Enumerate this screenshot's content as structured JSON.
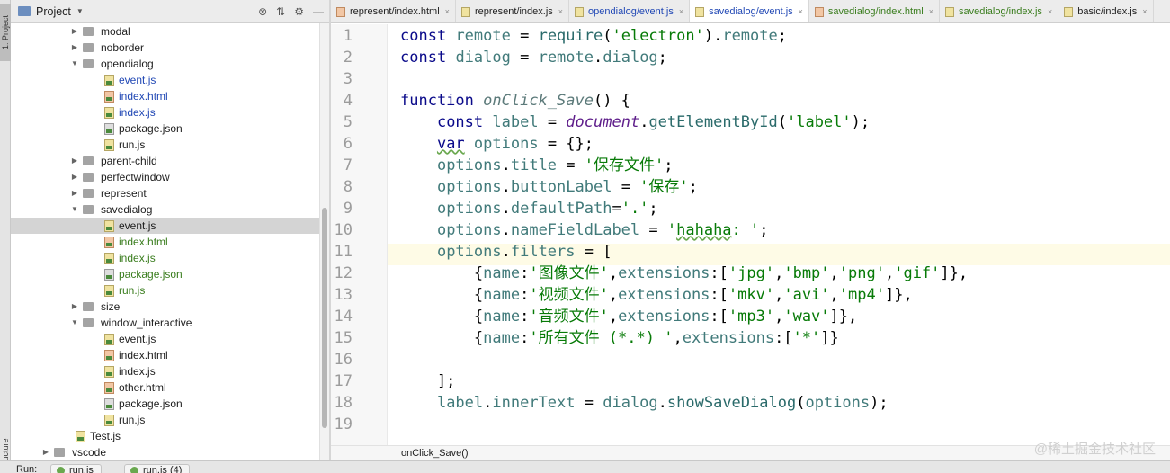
{
  "toolwindow": {
    "project_label": "1: Project",
    "structure_label": "Structure"
  },
  "project_panel": {
    "title": "Project",
    "tools": [
      "⊗",
      "⇅",
      "⚙",
      "—"
    ]
  },
  "tree": [
    {
      "label": "modal",
      "type": "folder",
      "indent": 1,
      "expanded": false,
      "color": "default"
    },
    {
      "label": "noborder",
      "type": "folder",
      "indent": 1,
      "expanded": false,
      "color": "default"
    },
    {
      "label": "opendialog",
      "type": "folder",
      "indent": 1,
      "expanded": true,
      "color": "default"
    },
    {
      "label": "event.js",
      "type": "js",
      "indent": 2,
      "color": "blue"
    },
    {
      "label": "index.html",
      "type": "html",
      "indent": 2,
      "color": "blue"
    },
    {
      "label": "index.js",
      "type": "js",
      "indent": 2,
      "color": "blue"
    },
    {
      "label": "package.json",
      "type": "json",
      "indent": 2,
      "color": "default"
    },
    {
      "label": "run.js",
      "type": "js",
      "indent": 2,
      "color": "default"
    },
    {
      "label": "parent-child",
      "type": "folder",
      "indent": 1,
      "expanded": false,
      "color": "default"
    },
    {
      "label": "perfectwindow",
      "type": "folder",
      "indent": 1,
      "expanded": false,
      "color": "default"
    },
    {
      "label": "represent",
      "type": "folder",
      "indent": 1,
      "expanded": false,
      "color": "default"
    },
    {
      "label": "savedialog",
      "type": "folder",
      "indent": 1,
      "expanded": true,
      "color": "default"
    },
    {
      "label": "event.js",
      "type": "js",
      "indent": 2,
      "color": "default",
      "selected": true
    },
    {
      "label": "index.html",
      "type": "html",
      "indent": 2,
      "color": "green"
    },
    {
      "label": "index.js",
      "type": "js",
      "indent": 2,
      "color": "green"
    },
    {
      "label": "package.json",
      "type": "json",
      "indent": 2,
      "color": "green"
    },
    {
      "label": "run.js",
      "type": "js",
      "indent": 2,
      "color": "green"
    },
    {
      "label": "size",
      "type": "folder",
      "indent": 1,
      "expanded": false,
      "color": "default"
    },
    {
      "label": "window_interactive",
      "type": "folder",
      "indent": 1,
      "expanded": true,
      "color": "default"
    },
    {
      "label": "event.js",
      "type": "js",
      "indent": 2,
      "color": "default"
    },
    {
      "label": "index.html",
      "type": "html",
      "indent": 2,
      "color": "default"
    },
    {
      "label": "index.js",
      "type": "js",
      "indent": 2,
      "color": "default"
    },
    {
      "label": "other.html",
      "type": "html",
      "indent": 2,
      "color": "default"
    },
    {
      "label": "package.json",
      "type": "json",
      "indent": 2,
      "color": "default"
    },
    {
      "label": "run.js",
      "type": "js",
      "indent": 2,
      "color": "default"
    },
    {
      "label": "Test.js",
      "type": "js",
      "indent": 0,
      "color": "default"
    },
    {
      "label": "vscode",
      "type": "folder",
      "indent": -1,
      "expanded": false,
      "color": "default"
    }
  ],
  "tabs": [
    {
      "label": "represent/index.html",
      "type": "html",
      "color": "default",
      "active": false
    },
    {
      "label": "represent/index.js",
      "type": "js",
      "color": "default",
      "active": false
    },
    {
      "label": "opendialog/event.js",
      "type": "js",
      "color": "blue",
      "active": false
    },
    {
      "label": "savedialog/event.js",
      "type": "js",
      "color": "blue",
      "active": true
    },
    {
      "label": "savedialog/index.html",
      "type": "html",
      "color": "green",
      "active": false
    },
    {
      "label": "savedialog/index.js",
      "type": "js",
      "color": "green",
      "active": false
    },
    {
      "label": "basic/index.js",
      "type": "js",
      "color": "default",
      "active": false
    }
  ],
  "editor": {
    "line_numbers": [
      "1",
      "2",
      "3",
      "4",
      "5",
      "6",
      "7",
      "8",
      "9",
      "10",
      "11",
      "12",
      "13",
      "14",
      "15",
      "16",
      "17",
      "18",
      "19"
    ],
    "code_lines": [
      "const remote = require('electron').remote;",
      "const dialog = remote.dialog;",
      "",
      "function onClick_Save() {",
      "    const label = document.getElementById('label');",
      "    var options = {};",
      "    options.title = '保存文件';",
      "    options.buttonLabel = '保存';",
      "    options.defaultPath='.';",
      "    options.nameFieldLabel = 'hahaha: ';",
      "    options.filters = [",
      "        {name:'图像文件',extensions:['jpg','bmp','png','gif']},",
      "        {name:'视频文件',extensions:['mkv','avi','mp4']},",
      "        {name:'音频文件',extensions:['mp3','wav']},",
      "        {name:'所有文件 (*.*) ',extensions:['*']}",
      "",
      "    ];",
      "    label.innerText = dialog.showSaveDialog(options);",
      ""
    ],
    "current_line": "11",
    "breadcrumb": "onClick_Save()"
  },
  "watermark": "@稀土掘金技术社区",
  "run_bar": {
    "label": "Run:",
    "tabs": [
      "run.js",
      "run.js (4)"
    ]
  }
}
